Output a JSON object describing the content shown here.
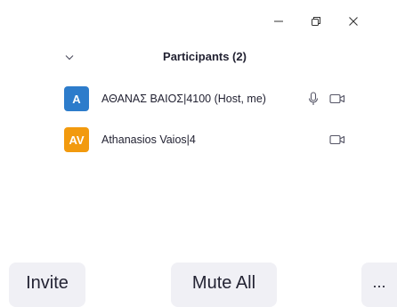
{
  "window_controls": {
    "minimize_icon": "minimize-icon",
    "restore_icon": "restore-icon",
    "close_icon": "close-icon"
  },
  "panel": {
    "title": "Participants (2)",
    "collapse_icon": "chevron-down-icon"
  },
  "participants": [
    {
      "initials": "A",
      "name": "ΑΘΑΝΑΣ ΒΑΙΟΣ|4100 (Host, me)",
      "avatar_color": "#2d7ccb",
      "mic_icon": "microphone-icon",
      "camera_icon": "video-camera-icon"
    },
    {
      "initials": "AV",
      "name": "Athanasios Vaios|4",
      "avatar_color": "#f29a0e",
      "camera_icon": "video-camera-icon"
    }
  ],
  "footer": {
    "invite_label": "Invite",
    "mute_all_label": "Mute All",
    "more_label": "..."
  },
  "colors": {
    "text": "#232333",
    "icon": "#555566",
    "button_bg": "#f0f0f5"
  }
}
